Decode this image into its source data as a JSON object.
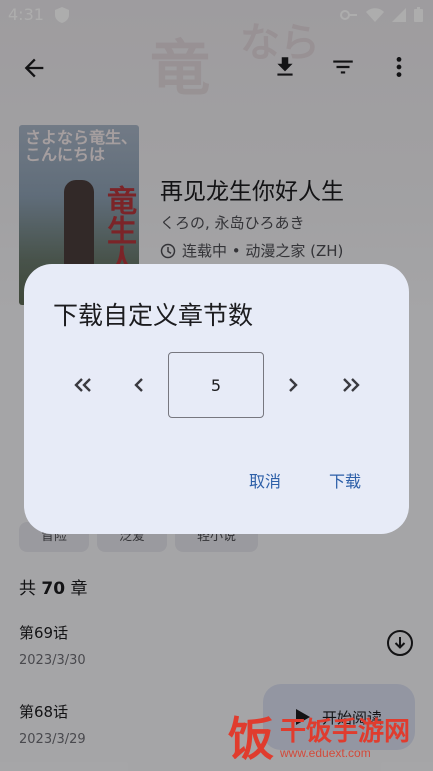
{
  "status_bar": {
    "time": "4:31"
  },
  "manga": {
    "title": "再见龙生你好人生",
    "authors": "くろの, 永岛ひろあき",
    "status_source": "连载中 • 动漫之家 (ZH)",
    "cover_text_top": "さよなら竜生、こんにちは",
    "cover_text_main": "竜生人生"
  },
  "genres": [
    "冒险",
    "泛爱",
    "轻小说"
  ],
  "chapter_count": {
    "prefix": "共",
    "number": "70",
    "suffix": "章"
  },
  "chapters": [
    {
      "name": "第69话",
      "date": "2023/3/30"
    },
    {
      "name": "第68话",
      "date": "2023/3/29"
    }
  ],
  "fab": {
    "label": "开始阅读"
  },
  "dialog": {
    "title": "下载自定义章节数",
    "value": "5",
    "cancel_label": "取消",
    "confirm_label": "下载"
  },
  "watermark": {
    "glyph": "饭",
    "name": "干饭手游网",
    "url": "www.eduext.com"
  },
  "colors": {
    "accent": "#2d5fa8",
    "dialog_bg": "#e7ebf7",
    "watermark": "#e03c2e"
  }
}
